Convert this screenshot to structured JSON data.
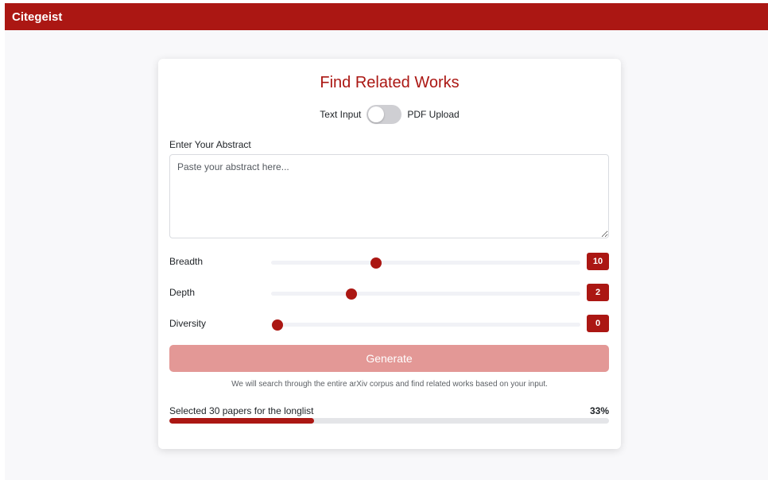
{
  "app": {
    "brand": "Citegeist"
  },
  "form": {
    "title": "Find Related Works",
    "mode_toggle": {
      "left_label": "Text Input",
      "right_label": "PDF Upload",
      "state": "Text Input"
    },
    "abstract": {
      "label": "Enter Your Abstract",
      "placeholder": "Paste your abstract here...",
      "value": ""
    },
    "sliders": [
      {
        "label": "Breadth",
        "value": "10",
        "position": 0.34
      },
      {
        "label": "Depth",
        "value": "2",
        "position": 0.26
      },
      {
        "label": "Diversity",
        "value": "0",
        "position": 0.02
      }
    ],
    "generate_label": "Generate",
    "note": "We will search through the entire arXiv corpus and find related works based on your input."
  },
  "progress": {
    "label": "Selected 30 papers for the longlist",
    "percent_text": "33%",
    "fraction": 0.33
  },
  "colors": {
    "accent": "#ab1713",
    "button_disabled": "#e39896"
  }
}
